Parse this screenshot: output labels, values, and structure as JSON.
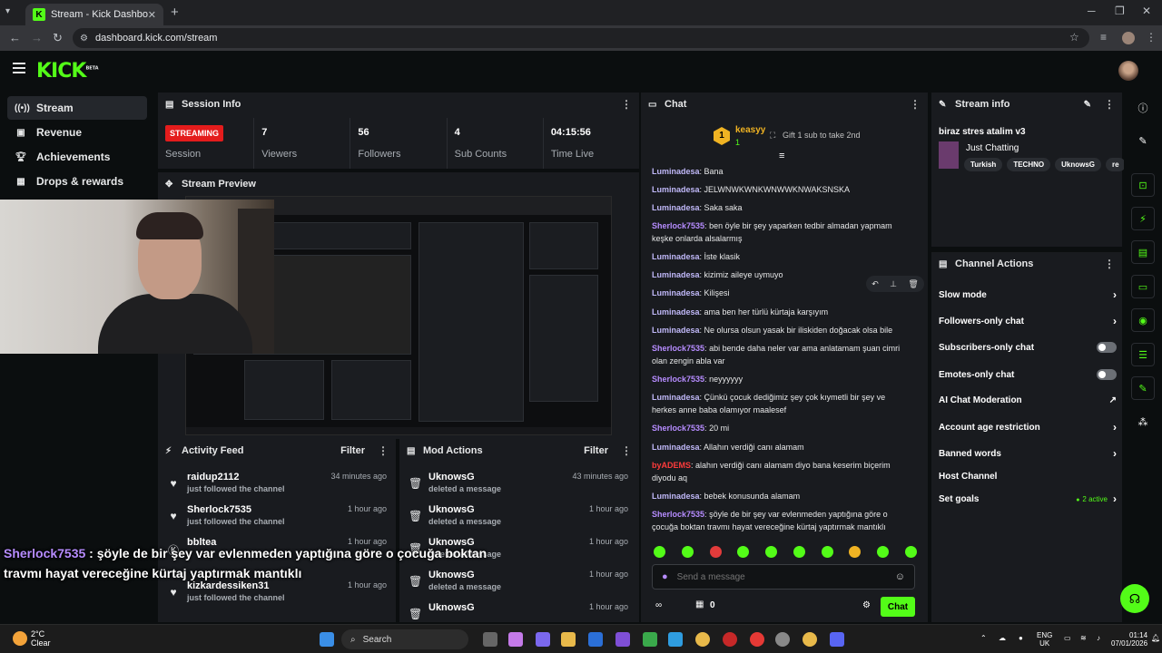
{
  "browser": {
    "tab_title": "Stream - Kick Dashboard",
    "url": "dashboard.kick.com/stream"
  },
  "header": {
    "logo": "KICK",
    "beta": "BETA"
  },
  "nav": [
    {
      "label": "Stream",
      "icon": "broadcast-icon"
    },
    {
      "label": "Revenue",
      "icon": "wallet-icon"
    },
    {
      "label": "Achievements",
      "icon": "trophy-icon"
    },
    {
      "label": "Drops & rewards",
      "icon": "gift-icon"
    }
  ],
  "session": {
    "title": "Session Info",
    "status": "STREAMING",
    "status_label": "Session",
    "viewers": "7",
    "viewers_label": "Viewers",
    "followers": "56",
    "followers_label": "Followers",
    "subs": "4",
    "subs_label": "Sub Counts",
    "time": "04:15:56",
    "time_label": "Time Live"
  },
  "preview": {
    "title": "Stream Preview"
  },
  "activity": {
    "title": "Activity Feed",
    "filter": "Filter",
    "items": [
      {
        "name": "raidup2112",
        "sub": "just followed the channel",
        "time": "34 minutes ago"
      },
      {
        "name": "Sherlock7535",
        "sub": "just followed the channel",
        "time": "1 hour ago"
      },
      {
        "name": "bbltea",
        "sub": "",
        "time": "1 hour ago"
      },
      {
        "name": "kizkardessiken31",
        "sub": "just followed the channel",
        "time": "1 hour ago"
      }
    ]
  },
  "mod": {
    "title": "Mod Actions",
    "filter": "Filter",
    "items": [
      {
        "name": "UknowsG",
        "sub": "deleted a message",
        "time": "43 minutes ago"
      },
      {
        "name": "UknowsG",
        "sub": "deleted a message",
        "time": "1 hour ago"
      },
      {
        "name": "UknowsG",
        "sub": "deleted a message",
        "time": "1 hour ago"
      },
      {
        "name": "UknowsG",
        "sub": "deleted a message",
        "time": "1 hour ago"
      },
      {
        "name": "UknowsG",
        "sub": "",
        "time": "1 hour ago"
      }
    ]
  },
  "overlay": {
    "user": "Sherlock7535",
    "line1": " : şöyle de bir şey var evlenmeden yaptığına göre o çocuğa boktan",
    "line2": "travmı hayat vereceğine kürtaj yaptırmak mantıklı"
  },
  "chat": {
    "title": "Chat",
    "top_user": "keasyy",
    "top_rank": "1",
    "top_count": "1",
    "gift_text": "Gift 1 sub to take 2nd",
    "messages": [
      {
        "user": "Luminadesa",
        "text": "Bana",
        "color": "c1"
      },
      {
        "user": "Luminadesa",
        "text": "JELWNWKWNKWNWWKNWAKSNSKA",
        "color": "c1"
      },
      {
        "user": "Luminadesa",
        "text": "Saka saka",
        "color": "c1"
      },
      {
        "user": "Sherlock7535",
        "text": "ben öyle bir şey yaparken tedbir almadan yapmam keşke onlarda alsalarmış",
        "color": "c2"
      },
      {
        "user": "Luminadesa",
        "text": "İste klasik",
        "color": "c1"
      },
      {
        "user": "Luminadesa",
        "text": "kizimiz aileye uymuyo",
        "color": "c1"
      },
      {
        "user": "Luminadesa",
        "text": "Kilişesi",
        "color": "c1"
      },
      {
        "user": "Luminadesa",
        "text": "ama ben her türlü kürtaja karşıyım",
        "color": "c1"
      },
      {
        "user": "Luminadesa",
        "text": "Ne olursa olsun yasak bir iliskiden doğacak olsa bile",
        "color": "c1"
      },
      {
        "user": "Sherlock7535",
        "text": "abi bende daha neler var ama anlatamam şuan cimri olan zengin abla var",
        "color": "c2"
      },
      {
        "user": "Sherlock7535",
        "text": "neyyyyyy",
        "color": "c2"
      },
      {
        "user": "Luminadesa",
        "text": "Çünkü çocuk dediğimiz şey çok kıymetli bir şey ve herkes anne baba olamıyor maalesef",
        "color": "c1"
      },
      {
        "user": "Sherlock7535",
        "text": "20 mi",
        "color": "c2"
      },
      {
        "user": "Luminadesa",
        "text": "Allahın verdiği canı alamam",
        "color": "c1"
      },
      {
        "user": "byADEMS",
        "text": "alahın verdiği canı alamam diyo bana keserim biçerim diyodu aq",
        "color": "c3"
      },
      {
        "user": "Luminadesa",
        "text": "bebek konusunda alamam",
        "color": "c1"
      },
      {
        "user": "Sherlock7535",
        "text": "şöyle de bir şey var evlenmeden yaptığına göre o çocuğa boktan travmı hayat vereceğine kürtaj yaptırmak mantıklı",
        "color": "c2"
      }
    ],
    "placeholder": "Send a message",
    "send": "Chat",
    "gift_count": "0"
  },
  "stream_info": {
    "title": "Stream info",
    "stream_title": "biraz stres atalim v3",
    "category": "Just Chatting",
    "tags": [
      "Turkish",
      "TECHNO",
      "UknowsG",
      "re"
    ]
  },
  "channel_actions": {
    "title": "Channel Actions",
    "items": [
      {
        "label": "Slow mode",
        "kind": "chevron"
      },
      {
        "label": "Followers-only chat",
        "kind": "chevron"
      },
      {
        "label": "Subscribers-only chat",
        "kind": "toggle"
      },
      {
        "label": "Emotes-only chat",
        "kind": "toggle"
      },
      {
        "label": "AI Chat Moderation",
        "kind": "external"
      },
      {
        "label": "Account age restriction",
        "kind": "chevron"
      },
      {
        "label": "Banned words",
        "kind": "chevron"
      },
      {
        "label": "Host Channel",
        "kind": "none"
      },
      {
        "label": "Set goals",
        "kind": "chevron",
        "extra": "2 active"
      }
    ]
  },
  "taskbar": {
    "temp": "2°C",
    "weather": "Clear",
    "search": "Search",
    "lang1": "ENG",
    "lang2": "UK",
    "time": "01:14",
    "date": "07/01/2026"
  }
}
